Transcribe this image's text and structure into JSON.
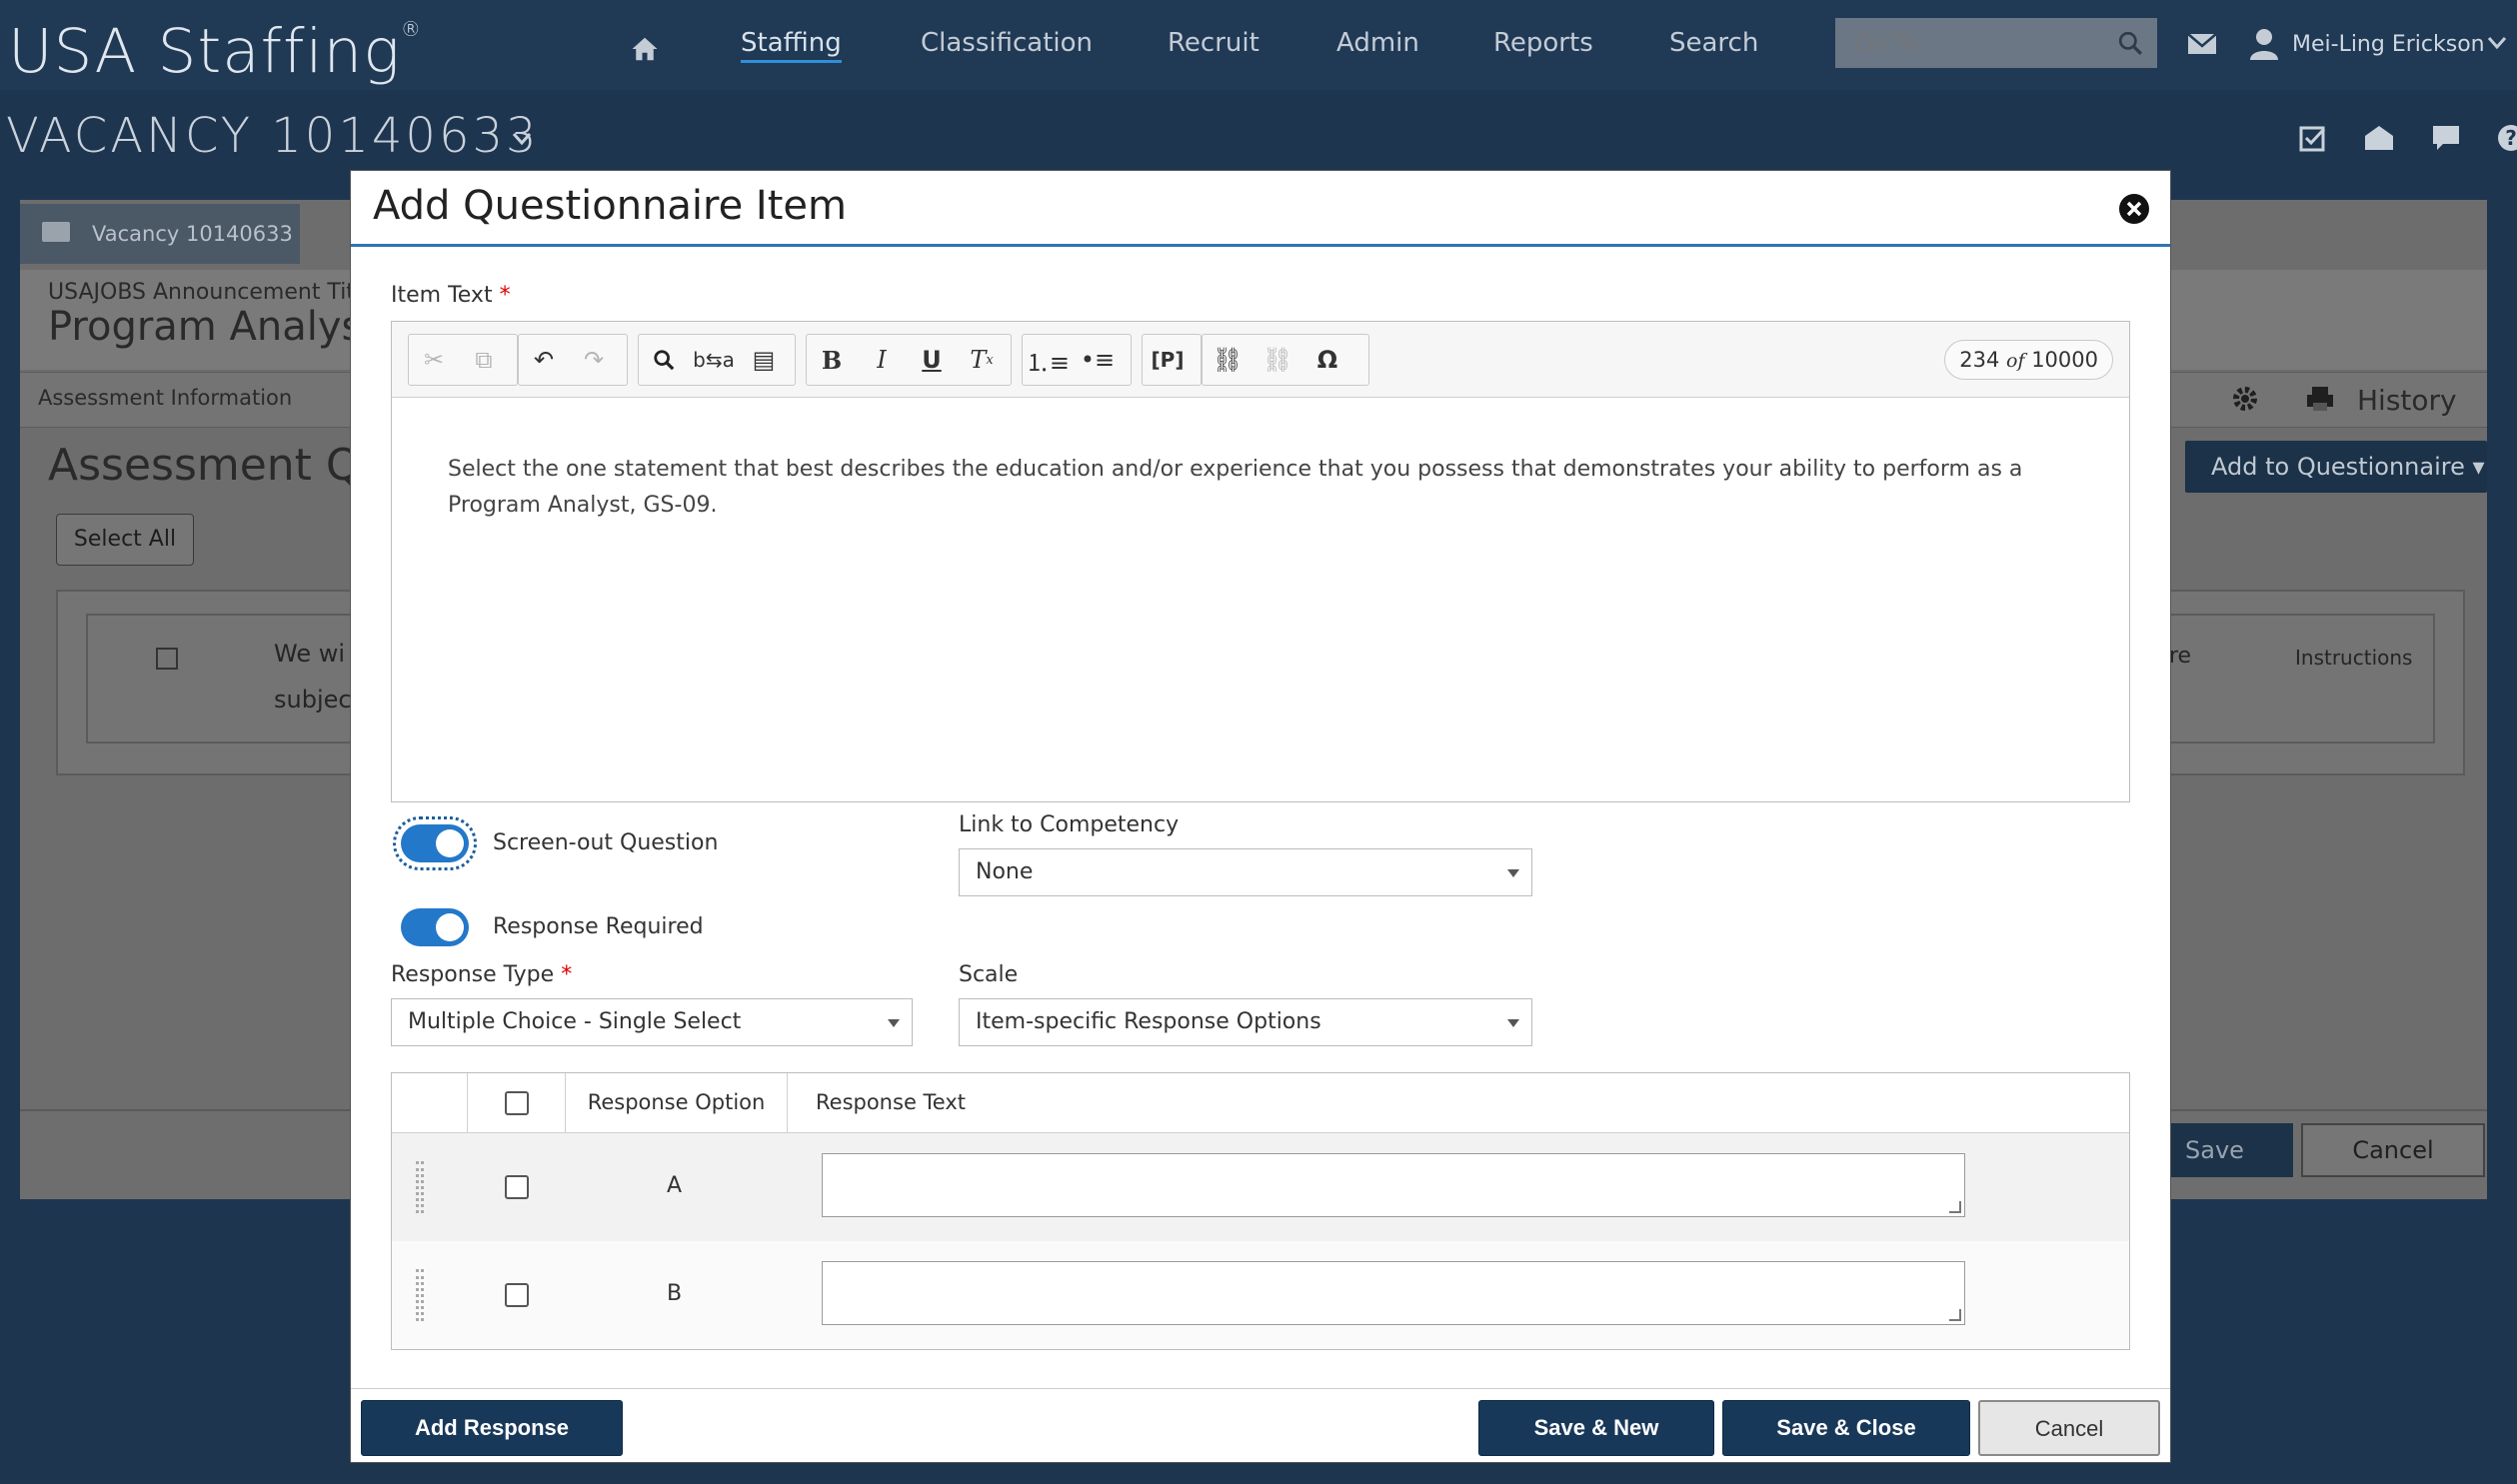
{
  "app": {
    "logo": "USA Staffing",
    "logo_mark": "®",
    "nav": [
      "Staffing",
      "Classification",
      "Recruit",
      "Admin",
      "Reports",
      "Search"
    ],
    "goto_placeholder": "Go To",
    "user_name": "Mei-Ling Erickson"
  },
  "vacancy": {
    "title": "VACANCY 10140633",
    "tab_label": "Vacancy 10140633"
  },
  "background": {
    "announcement_label": "USAJOBS Announcement Tit",
    "program_title": "Program Analyst",
    "subtab": "Assessment Information",
    "history": "History",
    "assessment_title": "Assessment Qu",
    "select_all": "Select All",
    "add_to_questionnaire": "Add to Questionnaire",
    "row_text_1": "We wi",
    "row_text_2": "subjec",
    "col_re": "re",
    "col_instructions": "Instructions",
    "save": "Save",
    "cancel": "Cancel"
  },
  "modal": {
    "title": "Add Questionnaire Item",
    "item_text_label": "Item Text",
    "required_mark": "*",
    "char_count": "234",
    "char_of": "of",
    "char_max": "10000",
    "item_text": "Select the one statement that best describes the education and/or experience that you possess that demonstrates your ability to perform as a Program Analyst, GS-09.",
    "screen_out_label": "Screen-out Question",
    "response_required_label": "Response Required",
    "link_competency_label": "Link to Competency",
    "link_competency_value": "None",
    "response_type_label": "Response Type",
    "response_type_value": "Multiple Choice - Single Select",
    "scale_label": "Scale",
    "scale_value": "Item-specific Response Options",
    "table_headers": {
      "option": "Response Option",
      "text": "Response Text"
    },
    "responses": [
      {
        "option": "A",
        "text": ""
      },
      {
        "option": "B",
        "text": ""
      }
    ],
    "buttons": {
      "add_response": "Add Response",
      "save_new": "Save & New",
      "save_close": "Save & Close",
      "cancel": "Cancel"
    }
  },
  "colors": {
    "nav_bg": "#203a56",
    "primary_button": "#18385a",
    "toggle_on": "#2378c9",
    "required": "#dd0000"
  }
}
